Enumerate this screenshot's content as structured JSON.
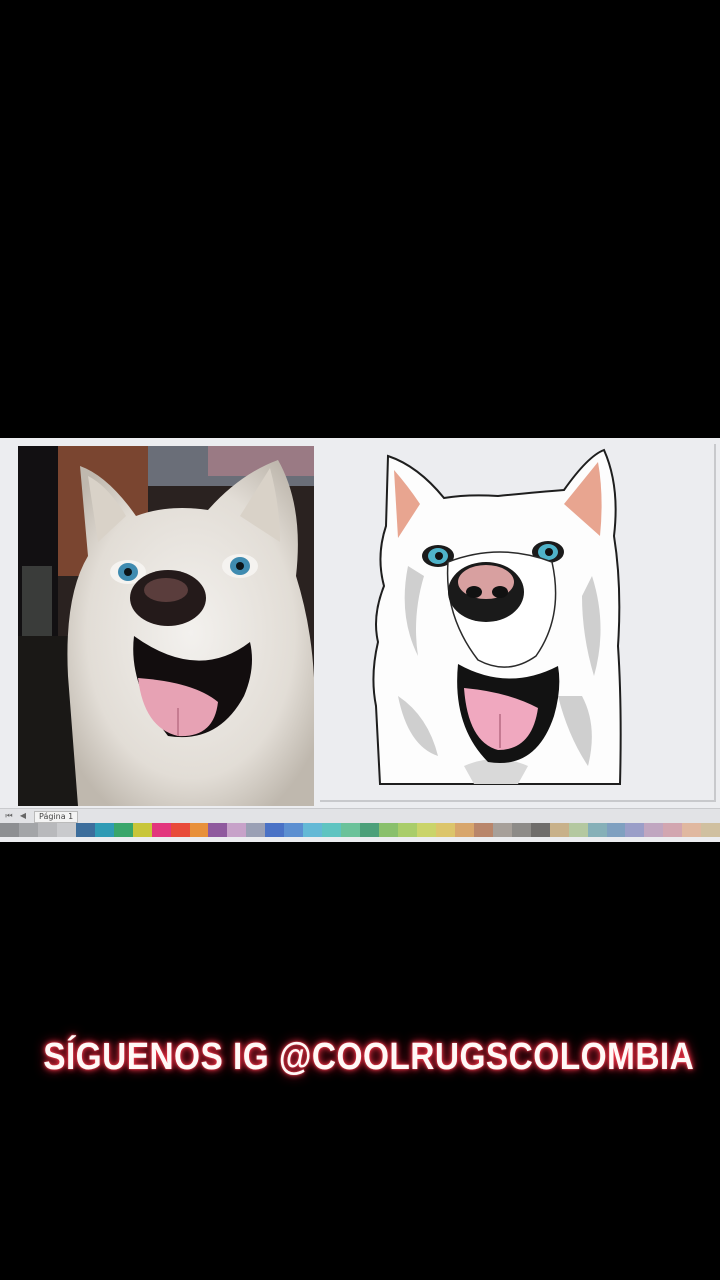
{
  "status_bar": {
    "page_tab_label": "Página 1"
  },
  "palette": {
    "colors": [
      "#8d8f92",
      "#a3a5a8",
      "#b8b9bc",
      "#c9cacd",
      "#3d6e9c",
      "#2f9bb5",
      "#39a66b",
      "#c8c63a",
      "#e2367d",
      "#e84b3a",
      "#e8903a",
      "#8f5a9e",
      "#c7a2c9",
      "#9aa0b5",
      "#4a72c6",
      "#5c8fd1",
      "#64b9d6",
      "#5fc4c1",
      "#6bc29a",
      "#4ca07a",
      "#89c06c",
      "#a9cd6a",
      "#cad46a",
      "#dcc56b",
      "#d8a66c",
      "#b9866b",
      "#a7a09a",
      "#8d8b88",
      "#6f6d6b",
      "#c8b18a",
      "#b4c8a0",
      "#86b0b8",
      "#7fa0c0",
      "#9a9ec8",
      "#c0a6c0",
      "#d2a6b0",
      "#e0b8a0",
      "#d0c0a0"
    ]
  },
  "caption": {
    "text": "SÍGUENOS IG @COOLRUGSCOLOMBIA"
  }
}
